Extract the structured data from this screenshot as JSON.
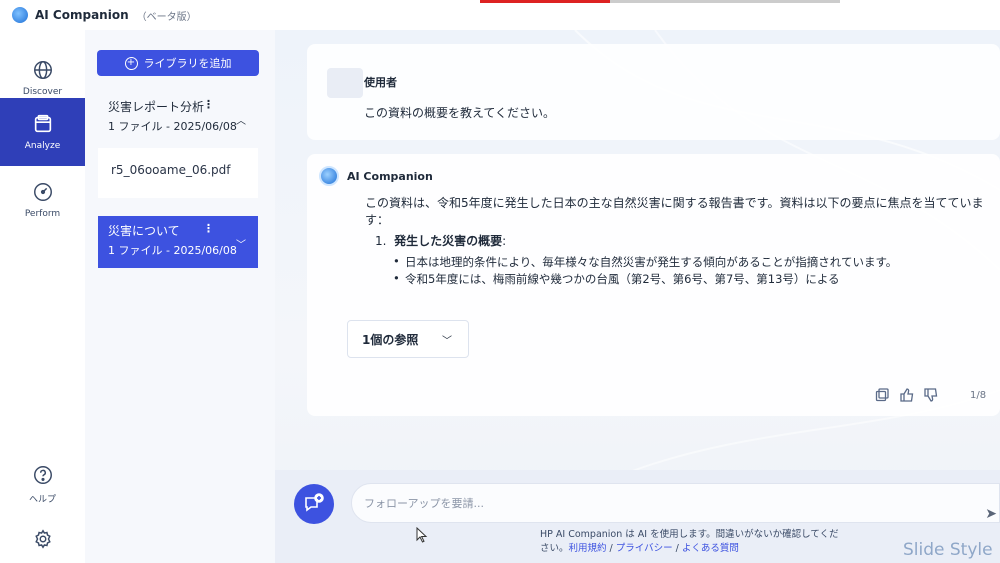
{
  "window": {
    "app_name": "AI Companion",
    "beta_label": "（ベータ版）"
  },
  "rail": {
    "items": [
      {
        "label": "Discover",
        "icon": "globe-icon"
      },
      {
        "label": "Analyze",
        "icon": "folder-icon",
        "active": true
      },
      {
        "label": "Perform",
        "icon": "gauge-icon"
      }
    ],
    "help_label": "ヘルプ",
    "settings_icon": "gear-icon"
  },
  "library": {
    "add_button": "ライブラリを追加",
    "groups": [
      {
        "title": "災害レポート分析",
        "meta": "1 ファイル - 2025/06/08",
        "expanded": true,
        "files": [
          "r5_06ooame_06.pdf"
        ]
      },
      {
        "title": "災害について",
        "meta": "1 ファイル - 2025/06/08",
        "expanded": false,
        "selected": true
      }
    ]
  },
  "chat": {
    "user": {
      "name": "使用者",
      "message": "この資料の概要を教えてください。"
    },
    "ai": {
      "name": "AI Companion",
      "intro": "この資料は、令和5年度に発生した日本の主な自然災害に関する報告書です。資料は以下の要点に焦点を当てています：",
      "list_number": "1.",
      "list_heading": "発生した災害の概要",
      "bullets": [
        "日本は地理的条件により、毎年様々な自然災害が発生する傾向があることが指摘されています。",
        "令和5年度には、梅雨前線や幾つかの台風（第2号、第6号、第7号、第13号）による"
      ],
      "references_label": "1個の参照",
      "pager": "1/8"
    }
  },
  "input": {
    "placeholder": "フォローアップを要請...",
    "disclaimer_text": "HP AI Companion は AI を使用します。間違いがないか確認してください。",
    "link_terms": "利用規約",
    "separator": " / ",
    "link_privacy": "プライバシー",
    "link_faq": "よくある質問"
  },
  "watermark": "Slide Style",
  "colors": {
    "accent": "#3d52e0",
    "rail_active": "#2f3fb8"
  }
}
